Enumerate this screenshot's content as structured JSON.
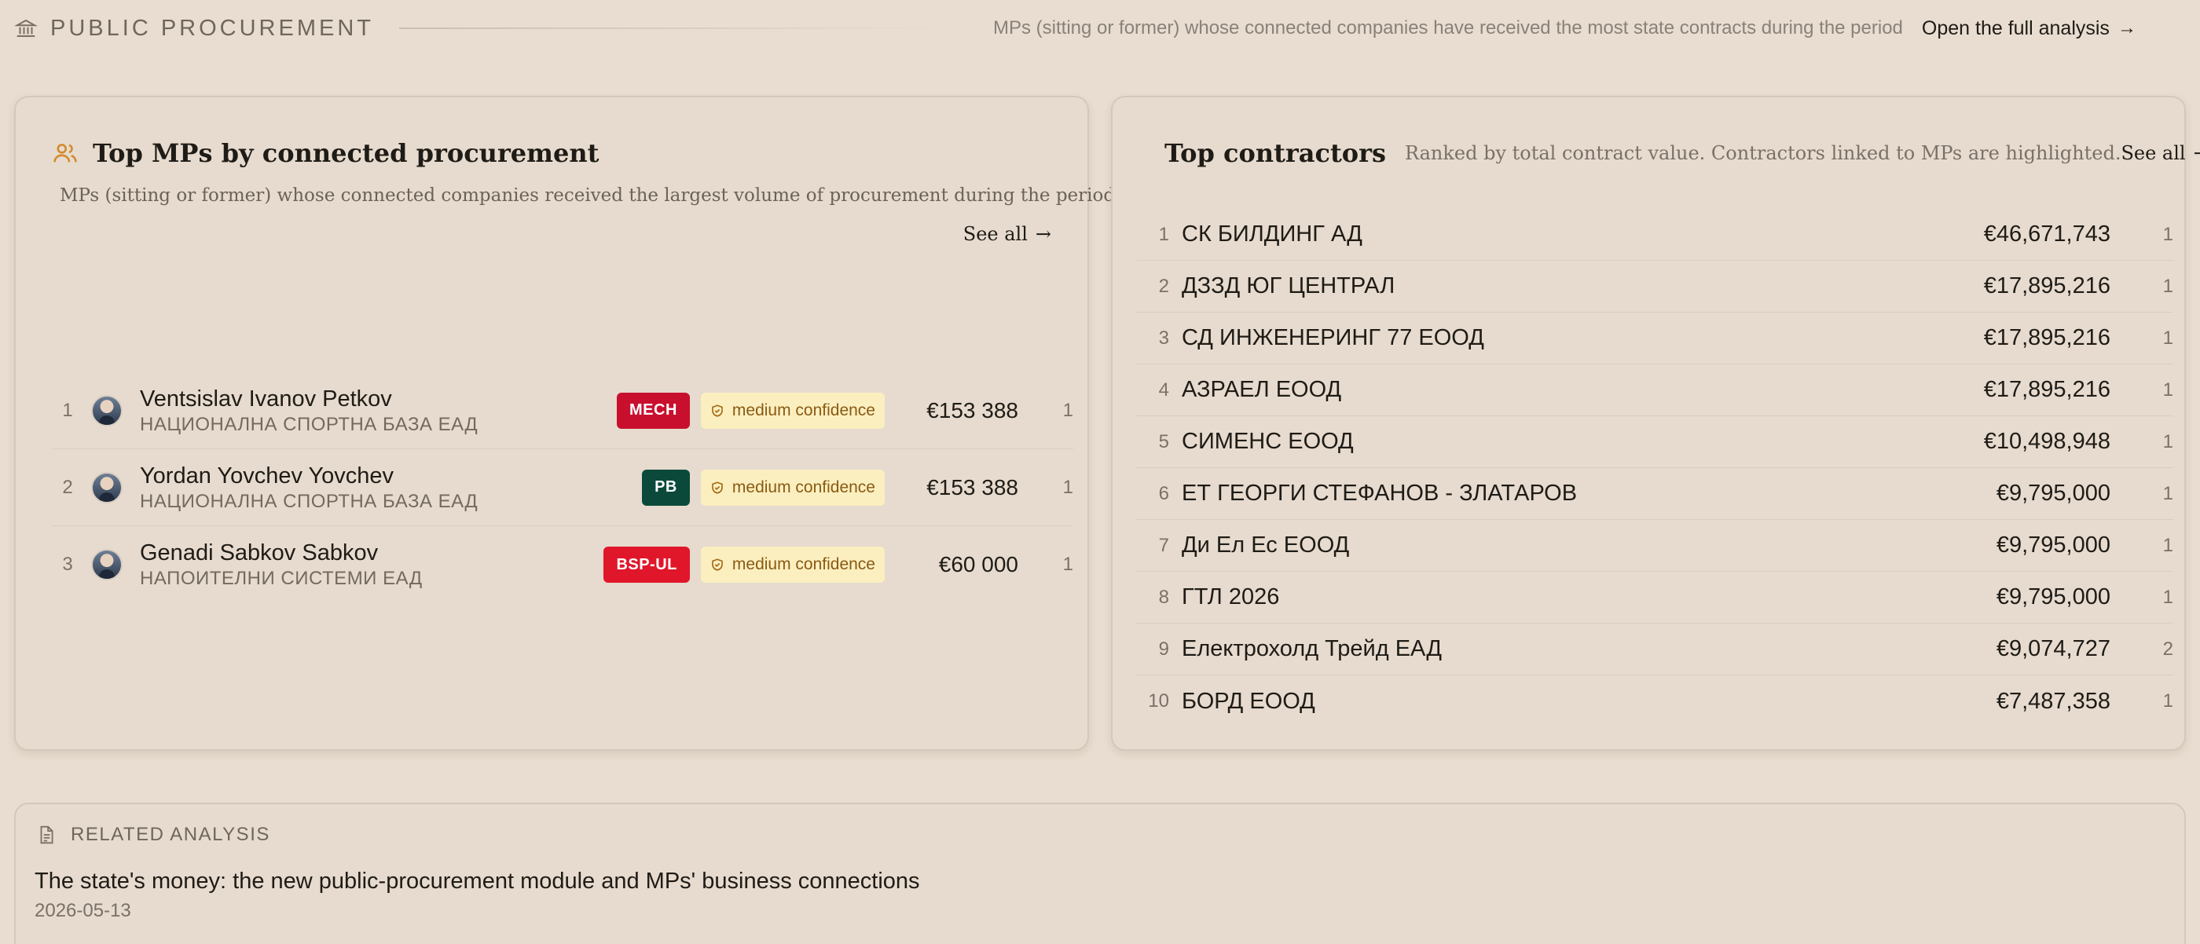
{
  "header": {
    "section_title": "PUBLIC PROCUREMENT",
    "description": "MPs (sitting or former) whose connected companies have received the most state contracts during the period",
    "open_link": "Open the full analysis",
    "icons": {
      "section": "bank-icon",
      "link": "arrow-right-icon"
    }
  },
  "top_mps": {
    "title": "Top MPs by connected procurement",
    "subtitle": "MPs (sitting or former) whose connected companies received the largest volume of procurement during the period.",
    "see_all": "See all",
    "icon": "people-icon",
    "rows": [
      {
        "rank": "1",
        "name": "Ventsislav Ivanov Petkov",
        "company": "НАЦИОНАЛНА СПОРТНА БАЗА ЕАД",
        "party": "MECH",
        "party_color": "#c8102e",
        "confidence": "medium confidence",
        "amount": "€153 388",
        "count": "1"
      },
      {
        "rank": "2",
        "name": "Yordan Yovchev Yovchev",
        "company": "НАЦИОНАЛНА СПОРТНА БАЗА ЕАД",
        "party": "PB",
        "party_color": "#0b4a3a",
        "confidence": "medium confidence",
        "amount": "€153 388",
        "count": "1"
      },
      {
        "rank": "3",
        "name": "Genadi Sabkov Sabkov",
        "company": "НАПОИТЕЛНИ СИСТЕМИ ЕАД",
        "party": "BSP-UL",
        "party_color": "#e0162b",
        "confidence": "medium confidence",
        "amount": "€60 000",
        "count": "1"
      }
    ]
  },
  "top_contractors": {
    "title": "Top contractors",
    "subtitle": "Ranked by total contract value. Contractors linked to MPs are highlighted.",
    "see_all": "See all",
    "icon": "dollar-icon",
    "rows": [
      {
        "rank": "1",
        "name": "СК БИЛДИНГ АД",
        "value": "€46,671,743",
        "count": "1"
      },
      {
        "rank": "2",
        "name": "ДЗЗД ЮГ ЦЕНТРАЛ",
        "value": "€17,895,216",
        "count": "1"
      },
      {
        "rank": "3",
        "name": "СД ИНЖЕНЕРИНГ 77 ЕООД",
        "value": "€17,895,216",
        "count": "1"
      },
      {
        "rank": "4",
        "name": "АЗРАЕЛ ЕООД",
        "value": "€17,895,216",
        "count": "1"
      },
      {
        "rank": "5",
        "name": "СИМЕНС ЕООД",
        "value": "€10,498,948",
        "count": "1"
      },
      {
        "rank": "6",
        "name": "ЕТ ГЕОРГИ СТЕФАНОВ - ЗЛАТАРОВ",
        "value": "€9,795,000",
        "count": "1"
      },
      {
        "rank": "7",
        "name": "Ди Ел Ес ЕООД",
        "value": "€9,795,000",
        "count": "1"
      },
      {
        "rank": "8",
        "name": "ГТЛ 2026",
        "value": "€9,795,000",
        "count": "1"
      },
      {
        "rank": "9",
        "name": "Електрохолд Трейд ЕАД",
        "value": "€9,074,727",
        "count": "2"
      },
      {
        "rank": "10",
        "name": "БОРД ЕООД",
        "value": "€7,487,358",
        "count": "1"
      }
    ]
  },
  "related": {
    "label": "RELATED ANALYSIS",
    "title": "The state's money: the new public-procurement module and MPs' business connections",
    "date": "2026-05-13",
    "icon": "document-icon"
  },
  "colors": {
    "background": "#e8ddd0",
    "card": "#e6dbce",
    "accent_orange": "#d4892a",
    "confidence_bg": "#fbefc0"
  }
}
